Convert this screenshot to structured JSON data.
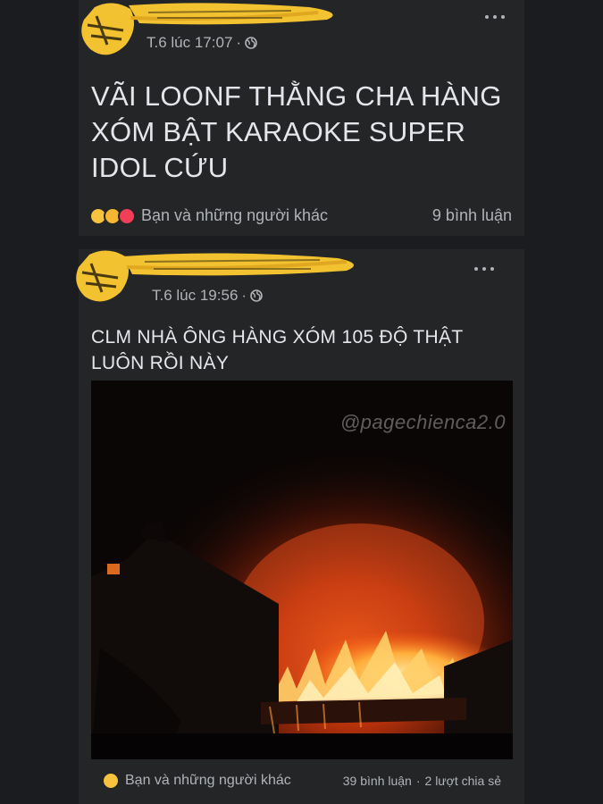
{
  "posts": [
    {
      "timestamp": "T.6 lúc 17:07",
      "separator": "·",
      "privacy_icon": "globe-icon",
      "text": "VÃI LOONF THẰNG CHA HÀNG XÓM BẬT KARAOKE SUPER IDOL CỨU",
      "reactions": [
        "sad-reaction",
        "haha-reaction",
        "love-reaction"
      ],
      "reactions_text": "Bạn và những người khác",
      "comments": "9 bình luận"
    },
    {
      "timestamp": "T.6 lúc 19:56",
      "separator": "·",
      "privacy_icon": "globe-icon",
      "text": "CLM NHÀ ÔNG HÀNG XÓM 105 ĐỘ THẬT LUÔN RỒI NÀY",
      "image": {
        "description_icon": "house-fire-photo",
        "watermark": "@pagechienca2.0"
      },
      "reactions": [
        "sad-reaction"
      ],
      "reactions_text": "Bạn và những người khác",
      "comments": "39 bình luận",
      "shares_separator": "·",
      "shares": "2 lượt chia sẻ"
    }
  ],
  "colors": {
    "background": "#1b1c20",
    "card": "#242526",
    "text": "#e4e6eb",
    "secondary": "#b0b3b8",
    "scribble": "#f2c230"
  }
}
